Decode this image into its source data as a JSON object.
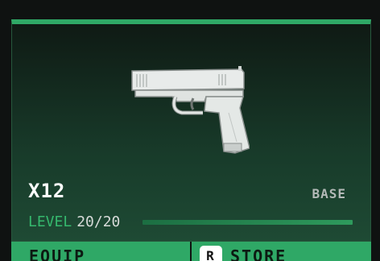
{
  "weapon": {
    "name": "X12",
    "variant": "BASE",
    "image_icon": "pistol-icon"
  },
  "level": {
    "label": "LEVEL",
    "value": "20/20",
    "progress": 1.0
  },
  "actions": {
    "equip_label": "EQUIP",
    "store_label": "STORE",
    "store_key": "R"
  },
  "colors": {
    "accent": "#2fa866",
    "level_text": "#35b86d"
  }
}
